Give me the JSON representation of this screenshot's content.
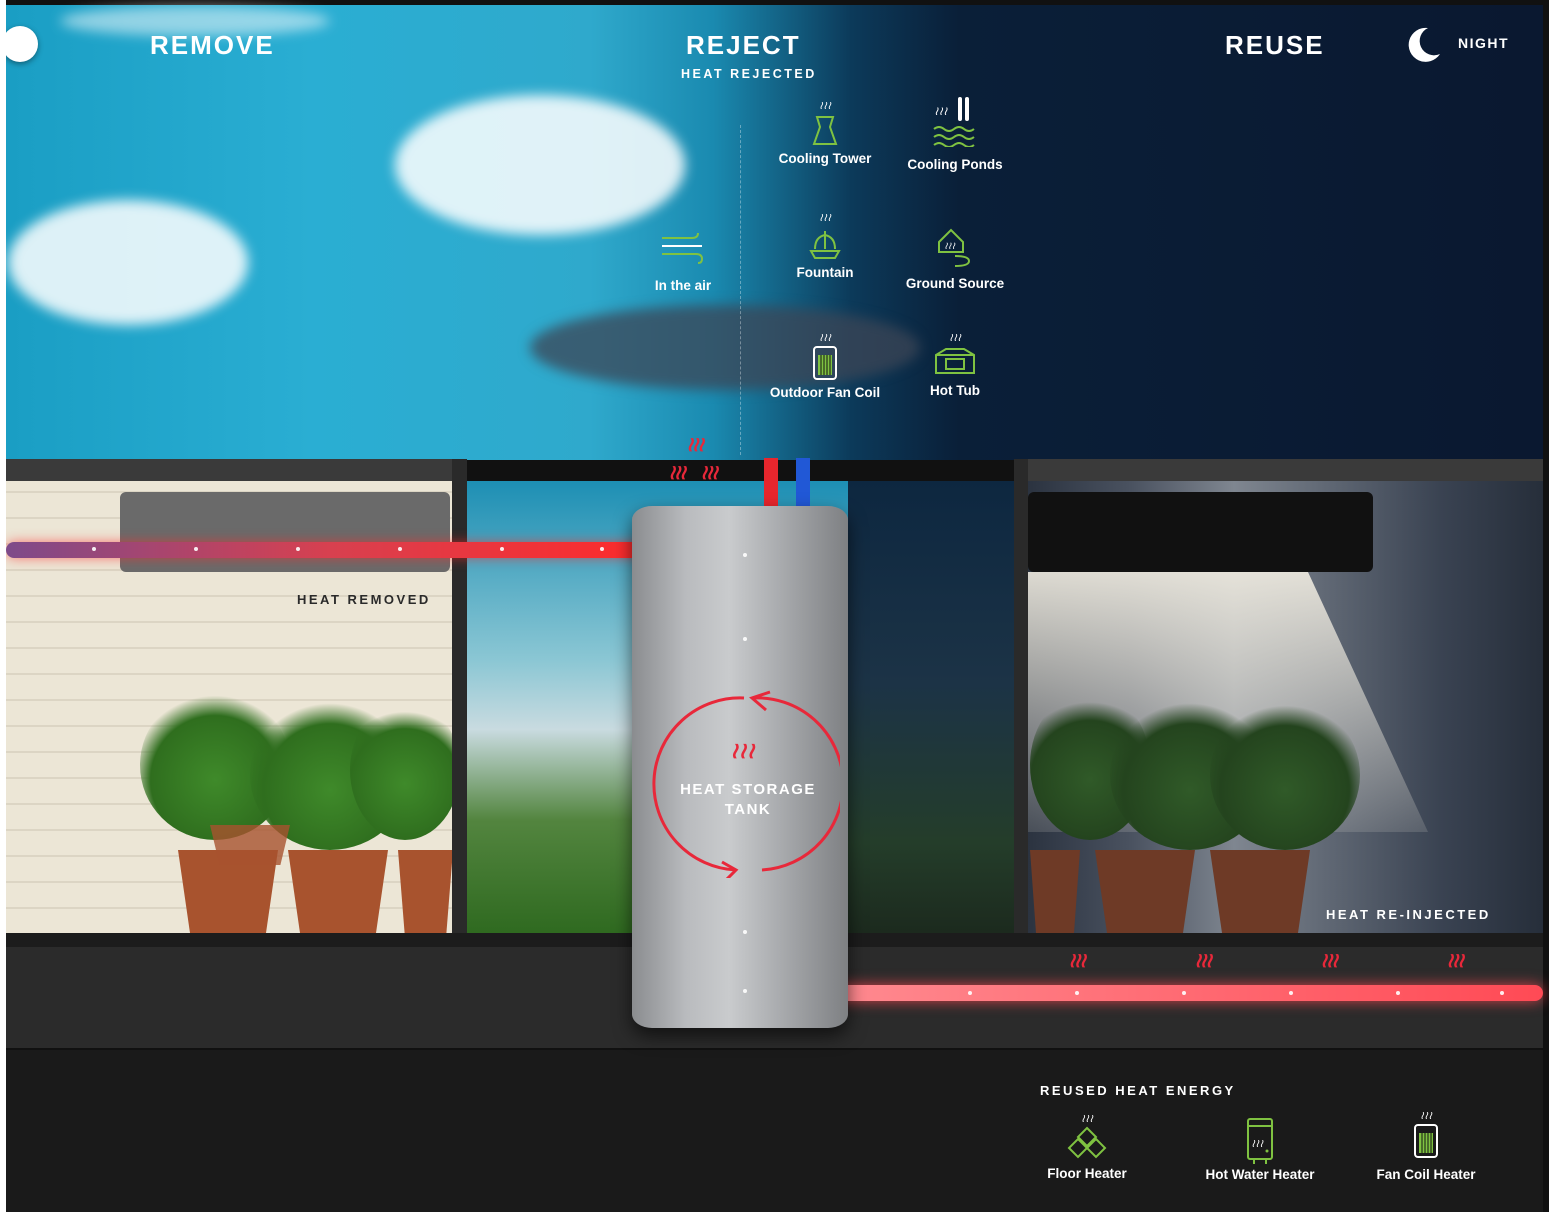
{
  "header": {
    "remove": "REMOVE",
    "reject": "REJECT",
    "reuse": "REUSE",
    "heat_rejected": "HEAT REJECTED",
    "night_label": "NIGHT"
  },
  "labels": {
    "heat_removed": "HEAT REMOVED",
    "heat_reinjected": "HEAT RE-INJECTED",
    "tank_line1": "HEAT STORAGE",
    "tank_line2": "TANK",
    "reused_heat_energy": "REUSED HEAT ENERGY"
  },
  "reject_options": [
    {
      "label": "Cooling Tower",
      "icon": "cooling-tower-icon"
    },
    {
      "label": "Cooling Ponds",
      "icon": "cooling-ponds-icon"
    },
    {
      "label": "In the air",
      "icon": "wind-icon"
    },
    {
      "label": "Fountain",
      "icon": "fountain-icon"
    },
    {
      "label": "Ground Source",
      "icon": "ground-source-icon"
    },
    {
      "label": "Outdoor Fan Coil",
      "icon": "fan-coil-icon"
    },
    {
      "label": "Hot Tub",
      "icon": "hot-tub-icon"
    }
  ],
  "reuse_options": [
    {
      "label": "Floor Heater",
      "icon": "floor-heater-icon"
    },
    {
      "label": "Hot Water Heater",
      "icon": "hot-water-heater-icon"
    },
    {
      "label": "Fan Coil Heater",
      "icon": "fan-coil-heater-icon"
    }
  ],
  "colors": {
    "accent_green": "#7fc241",
    "hot_red": "#e8283a",
    "cold_blue": "#2158d6"
  }
}
